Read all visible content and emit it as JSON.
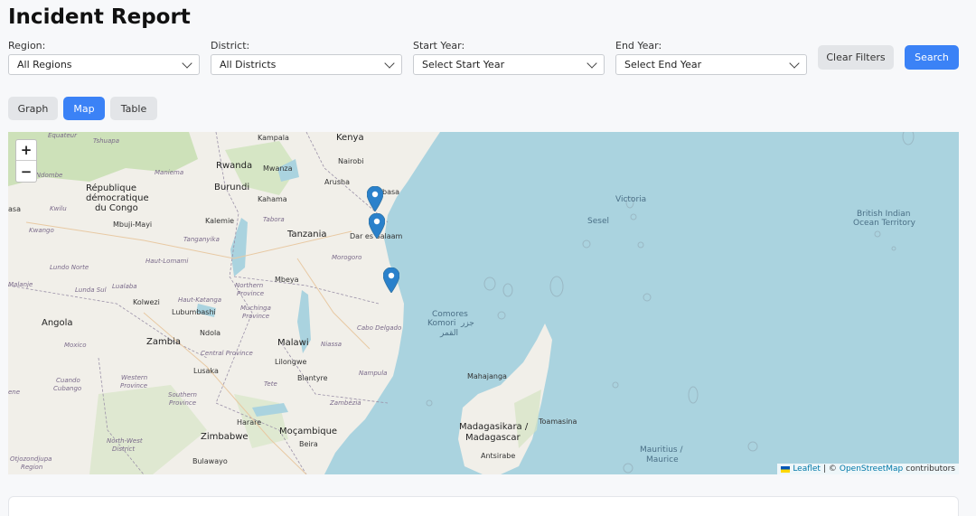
{
  "title": "Incident Report",
  "filters": {
    "region": {
      "label": "Region:",
      "value": "All Regions"
    },
    "district": {
      "label": "District:",
      "value": "All Districts"
    },
    "start_year": {
      "label": "Start Year:",
      "value": "Select Start Year"
    },
    "end_year": {
      "label": "End Year:",
      "value": "Select End Year"
    }
  },
  "buttons": {
    "clear": "Clear Filters",
    "search": "Search"
  },
  "view_tabs": [
    {
      "label": "Graph",
      "active": false
    },
    {
      "label": "Map",
      "active": true
    },
    {
      "label": "Table",
      "active": false
    }
  ],
  "map": {
    "zoom_in": "+",
    "zoom_out": "−",
    "attribution": {
      "leaflet": "Leaflet",
      "sep": "| ©",
      "osm": "OpenStreetMap",
      "suffix": "contributors"
    },
    "labels": {
      "equateur": "Equateur",
      "tshuapa": "Tshuapa",
      "kampala": "Kampala",
      "kenya": "Kenya",
      "nairobi": "Nairobi",
      "rwanda": "Rwanda",
      "mwanza": "Mwanza",
      "burundi": "Burundi",
      "maniema": "Maniema",
      "mai_ndombe": "Maï-Ndombe",
      "rdc": "République",
      "rdc2": "démocratique",
      "rdc3": "du Congo",
      "kahama": "Kahama",
      "arusha": "Arusha",
      "mombasa": "basa",
      "kwilu": "Kwilu",
      "asa": "asa",
      "mbuji_mayi": "Mbuji-Mayi",
      "kalemie": "Kalemie",
      "tabora": "Tabora",
      "tanzania": "Tanzania",
      "dar": "Dar es Salaam",
      "kwango": "Kwango",
      "tanganyika": "Tanganyika",
      "morogoro": "Morogoro",
      "lundo_norte": "Lundo Norte",
      "haut_lomami": "Haut-Lomami",
      "mbeya": "Mbeya",
      "malanje": "Malanje",
      "lunda_sul": "Lunda Sul",
      "lualaba": "Lualaba",
      "northern": "Northern",
      "province": "Province",
      "kolwezi": "Kolwezi",
      "haut_katanga": "Haut-Katanga",
      "lubumbashi": "Lubumbashi",
      "muchinga": "Muchinga",
      "province2": "Province",
      "angola": "Angola",
      "ndola": "Ndola",
      "moxico": "Moxico",
      "zambia": "Zambia",
      "malawi": "Malawi",
      "niassa": "Niassa",
      "cabo_delgado": "Cabo Delgado",
      "central_province": "Central Province",
      "lilongwe": "Lilongwe",
      "lusaka": "Lusaka",
      "nampula": "Nampula",
      "cuando": "Cuando",
      "cubango": "Cubango",
      "western": "Western",
      "province3": "Province",
      "tete": "Tete",
      "blantyre": "Blantyre",
      "southern": "Southern",
      "province4": "Province",
      "zambezia": "Zambézia",
      "harare": "Harare",
      "mocambique": "Moçambique",
      "zimbabwe": "Zimbabwe",
      "beira": "Beira",
      "north_west": "North-West",
      "district": "District",
      "otjozondjupa": "Otjozondjupa",
      "region": "Region",
      "bulawayo": "Bulawayo",
      "victoria": "Victoria",
      "sesel": "Sesel",
      "british": "British Indian",
      "ocean_territory": "Ocean Territory",
      "comores": "Comores",
      "komori": "Komori",
      "arabic1": "جزر",
      "arabic2": "القمر",
      "mahajanga": "Mahajanga",
      "madagasikara": "Madagasikara /",
      "madagascar": "Madagascar",
      "toamasina": "Toamasina",
      "antsirabe": "Antsirabe",
      "mauritius": "Mauritius /",
      "maurice": "Maurice",
      "ene": "ene"
    }
  },
  "colors": {
    "accent": "#3b82f6",
    "water": "#aad3df",
    "land": "#f1efe9",
    "green": "#c9dfb4",
    "marker": "#2a81cb"
  }
}
